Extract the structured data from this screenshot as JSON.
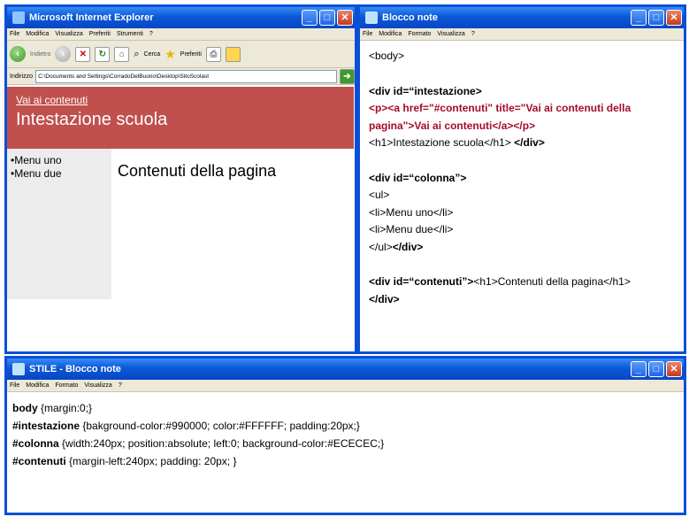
{
  "ie": {
    "title": "Microsoft Internet Explorer",
    "menu": [
      "File",
      "Modifica",
      "Visualizza",
      "Preferiti",
      "Strumenti",
      "?"
    ],
    "toolbar": {
      "back": "Indietro",
      "search": "Cerca",
      "favorites": "Preferiti"
    },
    "address_label": "Indirizzo",
    "address": "C:\\Documents and Settings\\CorradoDelBuono\\Desktop\\SitoScolast",
    "page": {
      "skip_link": "Vai ai contenuti",
      "heading": "Intestazione scuola",
      "menu_items": [
        "•Menu uno",
        "•Menu due"
      ],
      "content_heading": "Contenuti della pagina"
    }
  },
  "notepad": {
    "title": "Blocco note",
    "menu": [
      "File",
      "Modifica",
      "Formato",
      "Visualizza",
      "?"
    ],
    "lines": {
      "body": "<body>",
      "div_intest": "<div id=“intestazione>",
      "p_line1": "<p><a href=\"#contenuti\" title=\"Vai ai contenuti della",
      "p_line2": "pagina\">Vai ai contenuti</a></p>",
      "h1_intest": "<h1>Intestazione scuola</h1> ",
      "div_close1": "</div>",
      "div_colonna": "<div id=“colonna”>",
      "ul_open": "<ul>",
      "li1": "<li>Menu uno</li>",
      "li2": "<li>Menu due</li>",
      "ul_close": "</ul>",
      "div_close2": "</div>",
      "div_contenuti": "<div id=“contenuti”>",
      "h1_contenuti": "<h1>Contenuti della pagina</h1>",
      "div_close3": "</div>"
    }
  },
  "stile": {
    "title": "STILE - Blocco note",
    "menu": [
      "File",
      "Modifica",
      "Formato",
      "Visualizza",
      "?"
    ],
    "rules": [
      {
        "selector": "body",
        "decl": " {margin:0;}"
      },
      {
        "selector": "#intestazione",
        "decl": " {bakground-color:#990000; color:#FFFFFF; padding:20px;}"
      },
      {
        "selector": "#colonna",
        "decl": " {width:240px; position:absolute; left:0; background-color:#ECECEC;}"
      },
      {
        "selector": "#contenuti",
        "decl": " {margin-left:240px; padding: 20px; }"
      }
    ]
  },
  "colors": {
    "titlebar": "#0a58d8",
    "header_bg": "#c0504d",
    "column_bg": "#ececec",
    "code_red": "#a30c28"
  }
}
